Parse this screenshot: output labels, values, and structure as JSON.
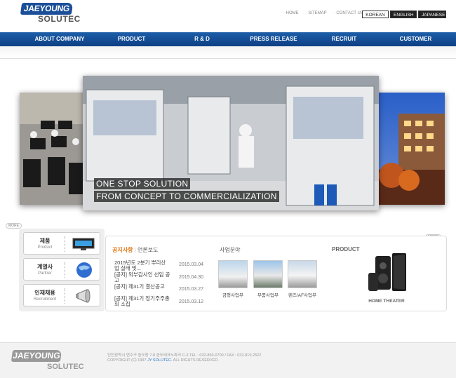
{
  "header": {
    "logo_text": "JAEYOUNG",
    "logo_sub": "SOLUTEC",
    "top_links": [
      "HOME",
      "SITEMAP",
      "CONTACT US"
    ],
    "languages": [
      {
        "label": "KOREAN",
        "active": true
      },
      {
        "label": "ENGLISH",
        "active": false
      },
      {
        "label": "JAPANESE",
        "active": false
      }
    ]
  },
  "nav": {
    "items": [
      "ABOUT COMPANY",
      "PRODUCT",
      "R & D",
      "PRESS RELEASE",
      "RECRUIT",
      "CUSTOMER"
    ]
  },
  "hero": {
    "caption_line1": "ONE STOP SOLUTION",
    "caption_line2": "FROM CONCEPT TO COMMERCIALIZATION"
  },
  "more_label": "MORE",
  "quick_links": [
    {
      "ko": "제품",
      "en": "Product",
      "icon": "monitor-icon"
    },
    {
      "ko": "계열사",
      "en": "Partner",
      "icon": "globe-icon"
    },
    {
      "ko": "인재채용",
      "en": "Recruitment",
      "icon": "megaphone-icon"
    }
  ],
  "news": {
    "tab_active": "공지사항",
    "tab_separator": "|",
    "tab_inactive": "언론보도",
    "items": [
      {
        "title": "2015년도 2분기 뿌리산업 실태 및...",
        "date": "2015.03.04"
      },
      {
        "title": "[공지] 외부감사인 선임 공고",
        "date": "2015.04.30"
      },
      {
        "title": "[공지] 제31기 결산공고",
        "date": "2015.03.27"
      },
      {
        "title": "[공지] 제31기 정기주주총회 소집",
        "date": "2015.03.12"
      }
    ]
  },
  "business": {
    "title": "사업분야",
    "items": [
      "금형사업부",
      "부품사업부",
      "렌즈/AF사업부"
    ]
  },
  "product": {
    "title": "PRODUCT",
    "label": "HOME THEATER"
  },
  "footer": {
    "logo_text": "JAEYOUNG",
    "logo_sub": "SOLUTEC",
    "address": "인천광역시 연수구 송도동 7-8 송도테크노파크 C-3  TEL : 032-850-0700 / FAX : 032-819-2522",
    "copyright_prefix": "COPYRIGHT (C) 1997",
    "copyright_brand": "JY SOLUTEC.",
    "copyright_suffix": "ALL RIGHTS RESERVED."
  },
  "colors": {
    "brand_blue": "#1b4f99",
    "nav_blue": "#1c5ea8",
    "news_accent": "#e07b1a"
  }
}
